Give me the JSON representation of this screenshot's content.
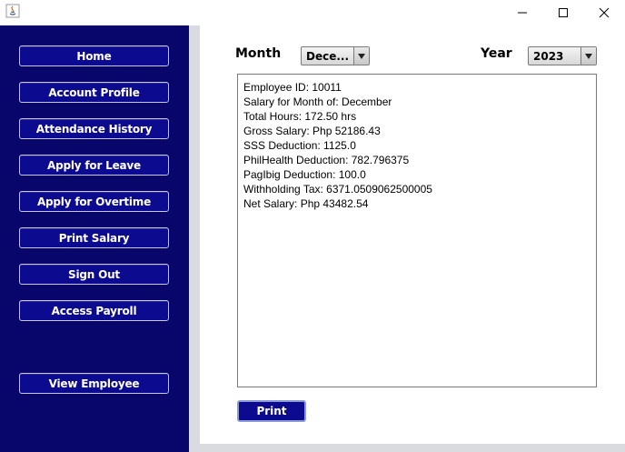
{
  "window": {
    "minimize_glyph": "—",
    "close_glyph": "✕"
  },
  "sidebar": {
    "items": [
      {
        "label": "Home"
      },
      {
        "label": "Account Profile"
      },
      {
        "label": "Attendance History"
      },
      {
        "label": "Apply for Leave"
      },
      {
        "label": "Apply for Overtime"
      },
      {
        "label": "Print Salary"
      },
      {
        "label": "Sign Out"
      },
      {
        "label": "Access Payroll"
      },
      {
        "label": "View Employee"
      }
    ]
  },
  "filters": {
    "month_label": "Month",
    "month_value": "Dece...",
    "year_label": "Year",
    "year_value": "2023"
  },
  "salary_report": {
    "lines": [
      "Employee ID: 10011",
      "Salary for Month of: December",
      "Total Hours: 172.50 hrs",
      "Gross Salary: Php 52186.43",
      "SSS Deduction: 1125.0",
      "PhilHealth Deduction: 782.796375",
      "PagIbig Deduction: 100.0",
      "Withholding Tax: 6371.0509062500005",
      "Net Salary: Php 43482.54"
    ]
  },
  "actions": {
    "print_label": "Print"
  },
  "colors": {
    "sidebar_bg": "#08066a",
    "button_bg": "#0c0a8e",
    "strip": "#d9dbe1"
  }
}
